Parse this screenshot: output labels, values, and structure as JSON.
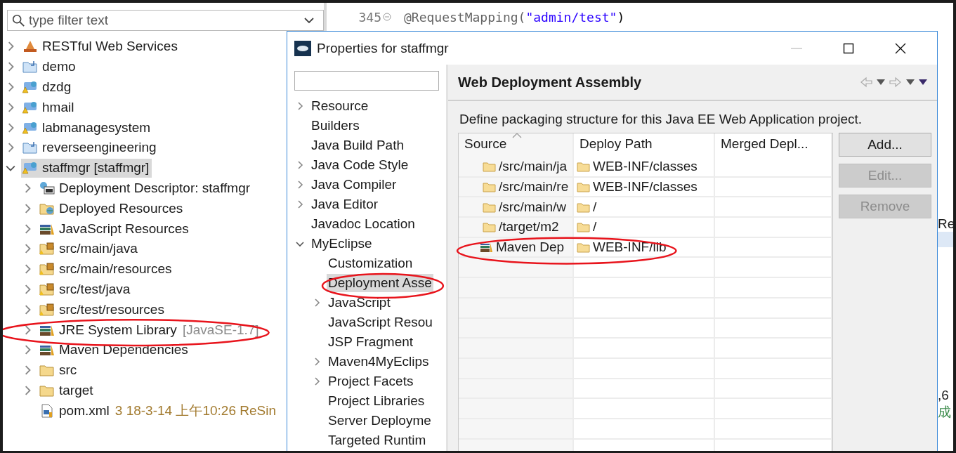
{
  "explorer": {
    "filter": {
      "placeholder": "type filter text"
    },
    "tree": [
      {
        "label": "RESTful Web Services",
        "kind": "rest",
        "expanded": false,
        "selected": false
      },
      {
        "label": "demo",
        "kind": "project",
        "expanded": false,
        "selected": false
      },
      {
        "label": "dzdg",
        "kind": "maven-project",
        "expanded": false,
        "selected": false
      },
      {
        "label": "hmail",
        "kind": "maven-project",
        "expanded": false,
        "selected": false
      },
      {
        "label": "labmanagesystem",
        "kind": "maven-project",
        "expanded": false,
        "selected": false
      },
      {
        "label": "reverseengineering",
        "kind": "project",
        "expanded": false,
        "selected": false
      },
      {
        "label": "staffmgr [staffmgr]",
        "kind": "maven-project",
        "expanded": true,
        "selected": true,
        "children": [
          {
            "label": "Deployment Descriptor: staffmgr",
            "kind": "descriptor",
            "expanded": false,
            "selected": false
          },
          {
            "label": "Deployed Resources",
            "kind": "deployed",
            "expanded": false,
            "selected": false
          },
          {
            "label": "JavaScript Resources",
            "kind": "library",
            "expanded": false,
            "selected": false
          },
          {
            "label": "src/main/java",
            "kind": "source-folder",
            "expanded": false,
            "selected": false
          },
          {
            "label": "src/main/resources",
            "kind": "source-folder",
            "expanded": false,
            "selected": false
          },
          {
            "label": "src/test/java",
            "kind": "source-folder",
            "expanded": false,
            "selected": false
          },
          {
            "label": "src/test/resources",
            "kind": "source-folder",
            "expanded": false,
            "selected": false
          },
          {
            "label": "JRE System Library",
            "decoration": "[JavaSE-1.7]",
            "kind": "library",
            "expanded": false,
            "selected": false,
            "circled": true
          },
          {
            "label": "Maven Dependencies",
            "kind": "library",
            "expanded": false,
            "selected": false
          },
          {
            "label": "src",
            "kind": "folder",
            "expanded": false,
            "selected": false
          },
          {
            "label": "target",
            "kind": "folder",
            "expanded": false,
            "selected": false
          },
          {
            "label": "pom.xml",
            "decoration": "3  18-3-14 上午10:26  ReSin",
            "kind": "file",
            "selected": false
          }
        ]
      }
    ]
  },
  "editor": {
    "lines": [
      {
        "number": "345",
        "folded": false,
        "tokens": [
          {
            "kind": "annotation",
            "text": "@RequestMapping("
          },
          {
            "kind": "string",
            "text": "\"admin/test\""
          },
          {
            "kind": "plain",
            "text": ")"
          }
        ]
      }
    ],
    "edge_fragments": [
      {
        "text": "Re"
      },
      {
        "text": ",6"
      },
      {
        "text": "成",
        "kind": "success"
      }
    ]
  },
  "dialog": {
    "title": "Properties for staffmgr",
    "nav_items": [
      {
        "label": "Resource",
        "expanded": false,
        "selected": false
      },
      {
        "label": "Builders",
        "selected": false
      },
      {
        "label": "Java Build Path",
        "selected": false
      },
      {
        "label": "Java Code Style",
        "expanded": false,
        "selected": false
      },
      {
        "label": "Java Compiler",
        "expanded": false,
        "selected": false
      },
      {
        "label": "Java Editor",
        "expanded": false,
        "selected": false
      },
      {
        "label": "Javadoc Location",
        "selected": false
      },
      {
        "label": "MyEclipse",
        "expanded": true,
        "selected": false,
        "children": [
          {
            "label": "Customization",
            "selected": false
          },
          {
            "label": "Deployment Asse",
            "selected": true,
            "circled": true
          },
          {
            "label": "JavaScript",
            "expanded": false,
            "selected": false
          },
          {
            "label": "JavaScript Resou",
            "selected": false
          },
          {
            "label": "JSP Fragment",
            "selected": false
          },
          {
            "label": "Maven4MyEclips",
            "expanded": false,
            "selected": false
          },
          {
            "label": "Project Facets",
            "expanded": false,
            "selected": false
          },
          {
            "label": "Project Libraries",
            "selected": false
          },
          {
            "label": "Server Deployme",
            "selected": false
          },
          {
            "label": "Targeted Runtim",
            "selected": false
          }
        ]
      }
    ],
    "page_title": "Web Deployment Assembly",
    "description": "Define packaging structure for this Java EE Web Application project.",
    "table": {
      "columns": [
        {
          "label": "Source",
          "sorted": true
        },
        {
          "label": "Deploy Path",
          "sorted": false
        },
        {
          "label": "Merged Depl...",
          "sorted": false
        }
      ],
      "rows": [
        {
          "source": "/src/main/ja",
          "kind": "folder",
          "deploy_path": "WEB-INF/classes",
          "circled": false
        },
        {
          "source": "/src/main/re",
          "kind": "folder",
          "deploy_path": "WEB-INF/classes",
          "circled": false
        },
        {
          "source": "/src/main/w",
          "kind": "folder",
          "deploy_path": "/",
          "circled": false
        },
        {
          "source": "/target/m2",
          "kind": "folder",
          "deploy_path": "/",
          "circled": false
        },
        {
          "source": "Maven Dep",
          "kind": "library",
          "deploy_path": "WEB-INF/lib",
          "circled": true
        }
      ]
    },
    "buttons": [
      {
        "label": "Add...",
        "disabled": false
      },
      {
        "label": "Edit...",
        "disabled": true
      },
      {
        "label": "Remove",
        "disabled": true
      }
    ]
  }
}
